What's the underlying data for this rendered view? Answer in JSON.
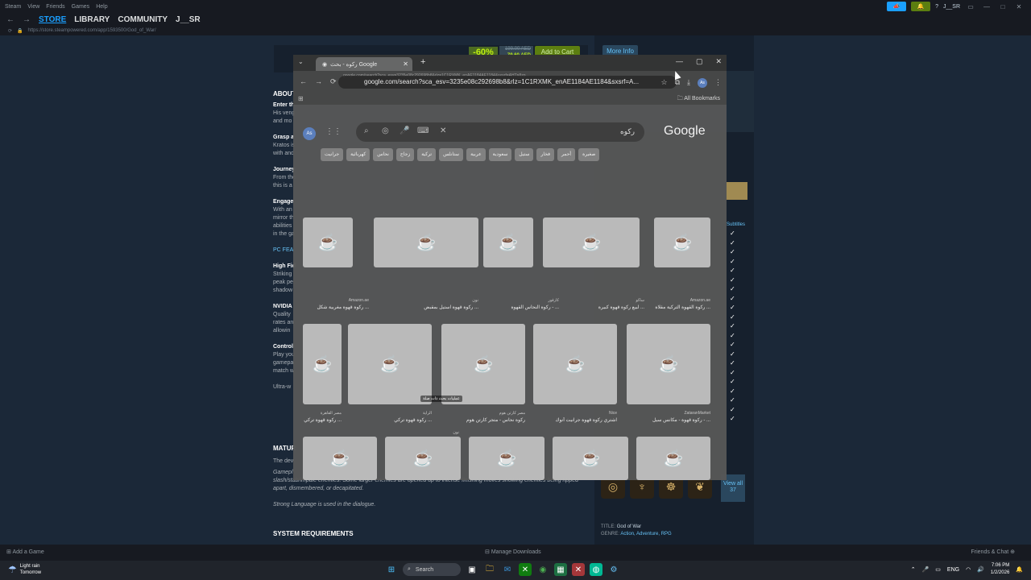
{
  "steam": {
    "menu": [
      "Steam",
      "View",
      "Friends",
      "Games",
      "Help"
    ],
    "account": "J__SR",
    "nav_tabs": [
      "STORE",
      "LIBRARY",
      "COMMUNITY",
      "J__SR"
    ],
    "url": "https://store.steampowered.com/app/1593500/God_of_War/",
    "discount": "-60%",
    "price_old": "199.00 AED",
    "price_new": "79.60 AED",
    "add_to_cart": "Add to Cart",
    "more_info": "More Info",
    "about": {
      "heading": "ABOUT",
      "p1_title": "Enter th",
      "p1": [
        "His veng",
        "and mo"
      ],
      "p2_title": "Grasp a",
      "p2": [
        "Kratos is",
        "with and"
      ],
      "p3_title": "Journey",
      "p3": [
        "From the",
        "this is a"
      ],
      "p4_title": "Engage",
      "p4": [
        "With an",
        "mirror th",
        "abilities",
        "in the ga"
      ],
      "pc_features": "PC FEA",
      "hf_title": "High Fid",
      "hf": [
        "Striking",
        "peak pe",
        "shadow"
      ],
      "nv_title": "NVIDIA",
      "nv": [
        "Quality",
        "rates an",
        "allowin"
      ],
      "ctrl_title": "Control",
      "ctrl": [
        "Play you",
        "gamepa",
        "match w"
      ],
      "ultra": "Ultra-w"
    },
    "mature": {
      "heading": "MATUR",
      "line1": "The dev",
      "line2_start": "Gamepl",
      "line3": "slash/stab/impale enemies. Some larger enemies are opened up to intense finishing moves showing enemies being ripped apart, dismembered, or decapitated.",
      "line4": "Strong Language is used in the dialogue."
    },
    "system_requirements": "SYSTEM REQUIREMENTS",
    "subtitles_header": "Subtitles",
    "view_all": "View all 37",
    "meta_title_label": "TITLE:",
    "meta_title": "God of War",
    "meta_genre_label": "GENRE:",
    "meta_genres": "Action, Adventure, RPG",
    "bottom": {
      "add_game": "Add a Game",
      "manage_downloads": "Manage Downloads",
      "friends_chat": "Friends & Chat"
    }
  },
  "browser": {
    "tab_title": "ركوه - بحث Google",
    "omnibox": "google.com/search?sca_esv=3235e08c292698b8&rlz=1C1RXMK_enAE1184AE1184&sxsrf=A...",
    "omnibox_ghost": "google.com/search?sca_esv=3235e08c292698b8&rlz=1C1RXMK_enAE1184AE1184&sxsrf=AHTn8zp...",
    "all_bookmarks": "All Bookmarks",
    "profile_initials": "As",
    "search_query": "ركوه",
    "google_logo": "Google",
    "chips": [
      "جرانيت",
      "كهربائية",
      "نحاس",
      "زجاج",
      "تركية",
      "ستانلس",
      "عربية",
      "سعودية",
      "ستيل",
      "فخار",
      "أحمر",
      "صغيرة"
    ],
    "results": [
      {
        "caption": "ركوة قهوة مغربية شكل ...",
        "source": "Amazon.ae"
      },
      {
        "caption": "ركوة قهوة استيل بمقبض ...",
        "source": "نون"
      },
      {
        "caption": "ركوة النحاس القهوة - ...",
        "source": "كارفور"
      },
      {
        "caption": "لبيع ركوة قهوة كبيرة ...",
        "source": "ساكو"
      },
      {
        "caption": "ركوة القهوة التركية مقلاة ...",
        "source": "Amazon.ae"
      },
      {
        "caption": "ركوة قهوة تركي ...",
        "source": "مصر القاهرة"
      },
      {
        "caption": "ركوة قهوة تركي ...",
        "source": "الراية"
      },
      {
        "caption": "ركوة نحاس - متجر كارتن هوم",
        "source": "مصر كارتن هوم"
      },
      {
        "caption": "اشتري ركوة قهوة جرانيت أنوك",
        "source": "Nice"
      },
      {
        "caption": "ركوة قهوة - مكانس سيل - ...",
        "source": "ZataranMarket"
      }
    ],
    "more_hint": "عمليات بحث ذات صلة",
    "extra_src": "نون"
  },
  "taskbar": {
    "weather_title": "Light rain",
    "weather_sub": "Tomorrow",
    "search": "Search",
    "lang": "ENG",
    "time": "7:06 PM",
    "date": "1/2/2026"
  }
}
